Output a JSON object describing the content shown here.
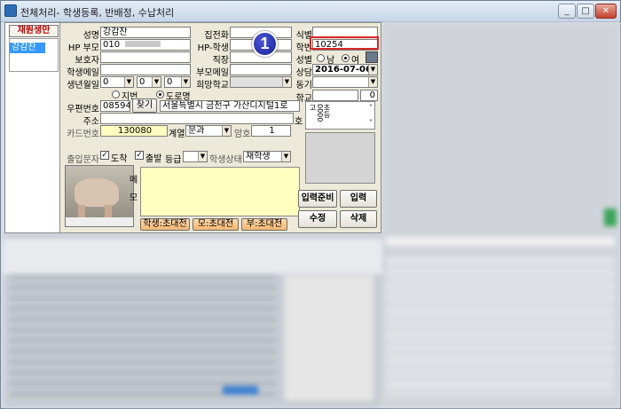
{
  "window": {
    "title": "전체처리- 학생등록, 반배정, 수납처리",
    "min_label": "_",
    "max_label": "□",
    "close_label": "✕"
  },
  "sidebar": {
    "tab_label": "재원생만",
    "selected_item": "강감찬"
  },
  "form": {
    "name_label": "성명",
    "name_value": "강감찬",
    "home_phone_label": "집전화",
    "home_phone_value": "",
    "id_label": "식별",
    "id_value": "",
    "hp_parent_label": "HP 부모",
    "hp_parent_value": "010",
    "hp_student_label": "HP-학생",
    "hp_student_value": "",
    "class_no_label": "학번",
    "class_no_value": "10254",
    "guardian_label": "보호자",
    "guardian_value": "",
    "job_label": "직장",
    "job_value": "",
    "gender_label": "성별",
    "gender_male": "남",
    "gender_female": "여",
    "student_email_label": "학생메일",
    "student_email_value": "",
    "parent_email_label": "부모메일",
    "parent_email_value": "",
    "consult_label": "상담",
    "consult_value": "2016-07-06",
    "birth_label": "생년월일",
    "birth_y": "0",
    "birth_m": "0",
    "birth_d": "0",
    "hope_school_label": "희망학교",
    "hope_school_value": "",
    "motive_label": "동기",
    "motive_value": "",
    "addr_type_jibun": "지번",
    "addr_type_road": "도로명",
    "school_label": "학교",
    "school_value": "",
    "school_num": "0",
    "zip_label": "우편번호",
    "zip_value": "08594",
    "find_button": "찾기",
    "address_value": "서울특별시 금천구 가산디지털1로",
    "address_label": "주소",
    "address_detail": "",
    "address_cut": "호",
    "card_label": "카드번호",
    "card_value": "130080",
    "track_label": "계열",
    "track_value": "문과",
    "password_label": "암호",
    "password_value": "1",
    "vertical_list_text": "초등0000고",
    "sms_label": "출입문자",
    "arrive_label": "도착",
    "leave_label": "출발",
    "grade_label": "등급",
    "grade_value": "",
    "status_label": "학생상태",
    "status_value": "재학생",
    "memo_label_1": "메",
    "memo_label_2": "모",
    "memo_value": "",
    "invite_student": "학생:초대전",
    "invite_mother": "모:초대전",
    "invite_father": "부:초대전",
    "ready_button": "입력준비",
    "input_button": "입력",
    "edit_button": "수정",
    "delete_button": "삭제"
  },
  "annotation": {
    "badge_number": "1"
  },
  "colors": {
    "highlight_border": "#d7282a",
    "badge_fill": "#1a2296",
    "memo_bg": "#ffffc0",
    "sidebar_tab_text": "#c00000"
  }
}
